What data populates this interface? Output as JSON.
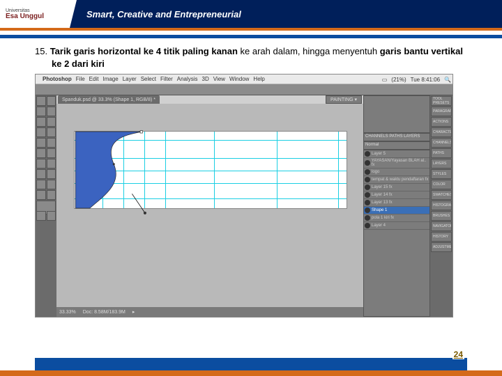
{
  "header": {
    "uni_line1": "Universitas",
    "uni_line2": "Esa Unggul",
    "tagline": "Smart, Creative and Entrepreneurial"
  },
  "step": {
    "num": "15. ",
    "bold1": "Tarik garis horizontal ke 4 titik paling kanan ",
    "plain1": "ke arah dalam, hingga menyentuh ",
    "bold2": "garis bantu vertikal ke 2 dari kiri"
  },
  "mac": {
    "app": "Photoshop",
    "menus": [
      "File",
      "Edit",
      "Image",
      "Layer",
      "Select",
      "Filter",
      "Analysis",
      "3D",
      "View",
      "Window",
      "Help"
    ],
    "battery": "(21%)",
    "clock": "Tue 8:41:06"
  },
  "doc_tab": "Spanduk.psd @ 33.3% (Shape 1, RGB/8) *",
  "paint_label": "PAINTING ▾",
  "side_tabs": [
    "TOOL PRESETS",
    "PARAGRAPH",
    "ACTIONS",
    "CHARACTER",
    "CHANNELS",
    "PATHS",
    "LAYERS",
    "STYLES",
    "COLOR",
    "SWATCHES",
    "HISTOGRAM",
    "BRUSHES",
    "NAVIGATOR",
    "HISTORY",
    "ADJUSTMENTS"
  ],
  "panel_tabs": "CHANNELS  PATHS  LAYERS",
  "layers_mode": "Normal",
  "layers": [
    {
      "name": "Layer 5"
    },
    {
      "name": "YAYASAN/Yayasan BLAH al..  fx"
    },
    {
      "name": "logo"
    },
    {
      "name": "tempat & waktu pendaftaran  fx"
    },
    {
      "name": "Layer 15  fx"
    },
    {
      "name": "Layer 14  fx"
    },
    {
      "name": "Layer 13  fx"
    },
    {
      "name": "Shape 1",
      "sel": true
    },
    {
      "name": "pola 1 kiri  fx"
    },
    {
      "name": "Layer 4"
    }
  ],
  "status": {
    "zoom": "33.33%",
    "doc": "Doc: 8.58M/183.9M"
  },
  "footer": {
    "page": "24"
  }
}
